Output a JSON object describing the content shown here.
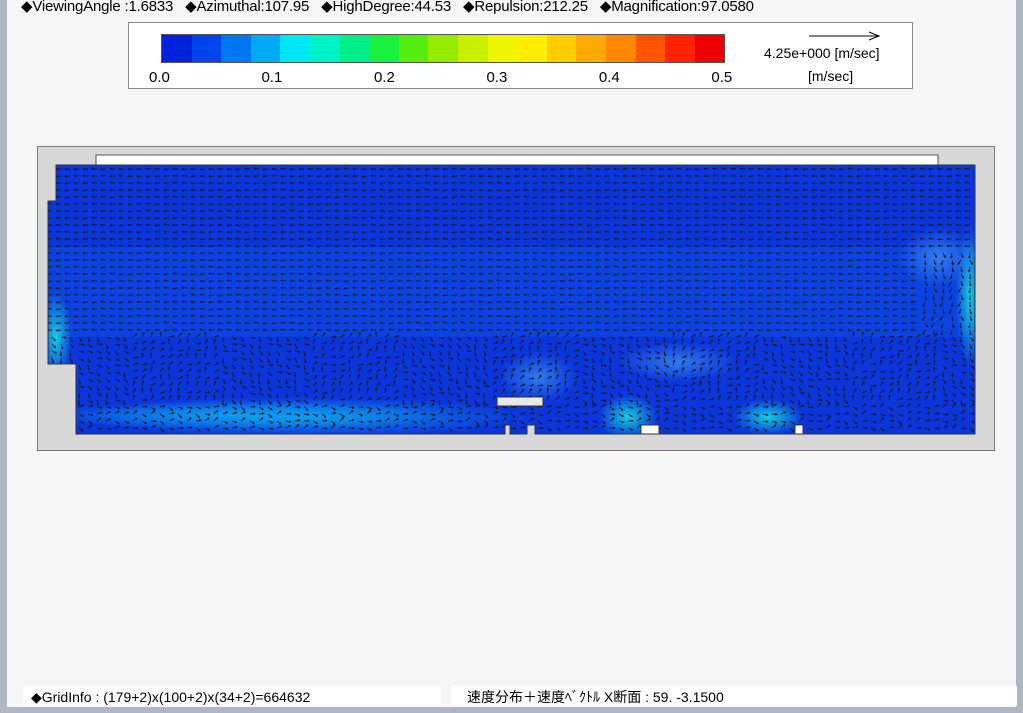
{
  "view_params": {
    "viewing_angle": "◆ViewingAngle :1.6833",
    "azimuthal": "◆Azimuthal:107.95",
    "high_degree": "◆HighDegree:44.53",
    "repulsion": "◆Repulsion:212.25",
    "magnification": "◆Magnification:97.0580"
  },
  "legend": {
    "colors": [
      "#0022dd",
      "#0044ee",
      "#0077f2",
      "#00aaf6",
      "#00e6f4",
      "#00f2c8",
      "#00ee8a",
      "#18f040",
      "#55ee10",
      "#96ec00",
      "#c8f000",
      "#eef600",
      "#ffee00",
      "#ffcc00",
      "#ffaa00",
      "#ff8800",
      "#ff5500",
      "#ff2200",
      "#ee0000"
    ],
    "ticks": [
      "0.0",
      "0.1",
      "0.2",
      "0.3",
      "0.4",
      "0.5"
    ],
    "reference_vector": "4.25e+000  [m/sec]",
    "unit": "[m/sec]"
  },
  "status": {
    "grid_info": "◆GridInfo : (179+2)x(100+2)x(34+2)=664632",
    "section_info": "速度分布＋速度ﾍﾞｸﾄﾙ X断面 : 59.  -3.1500"
  }
}
